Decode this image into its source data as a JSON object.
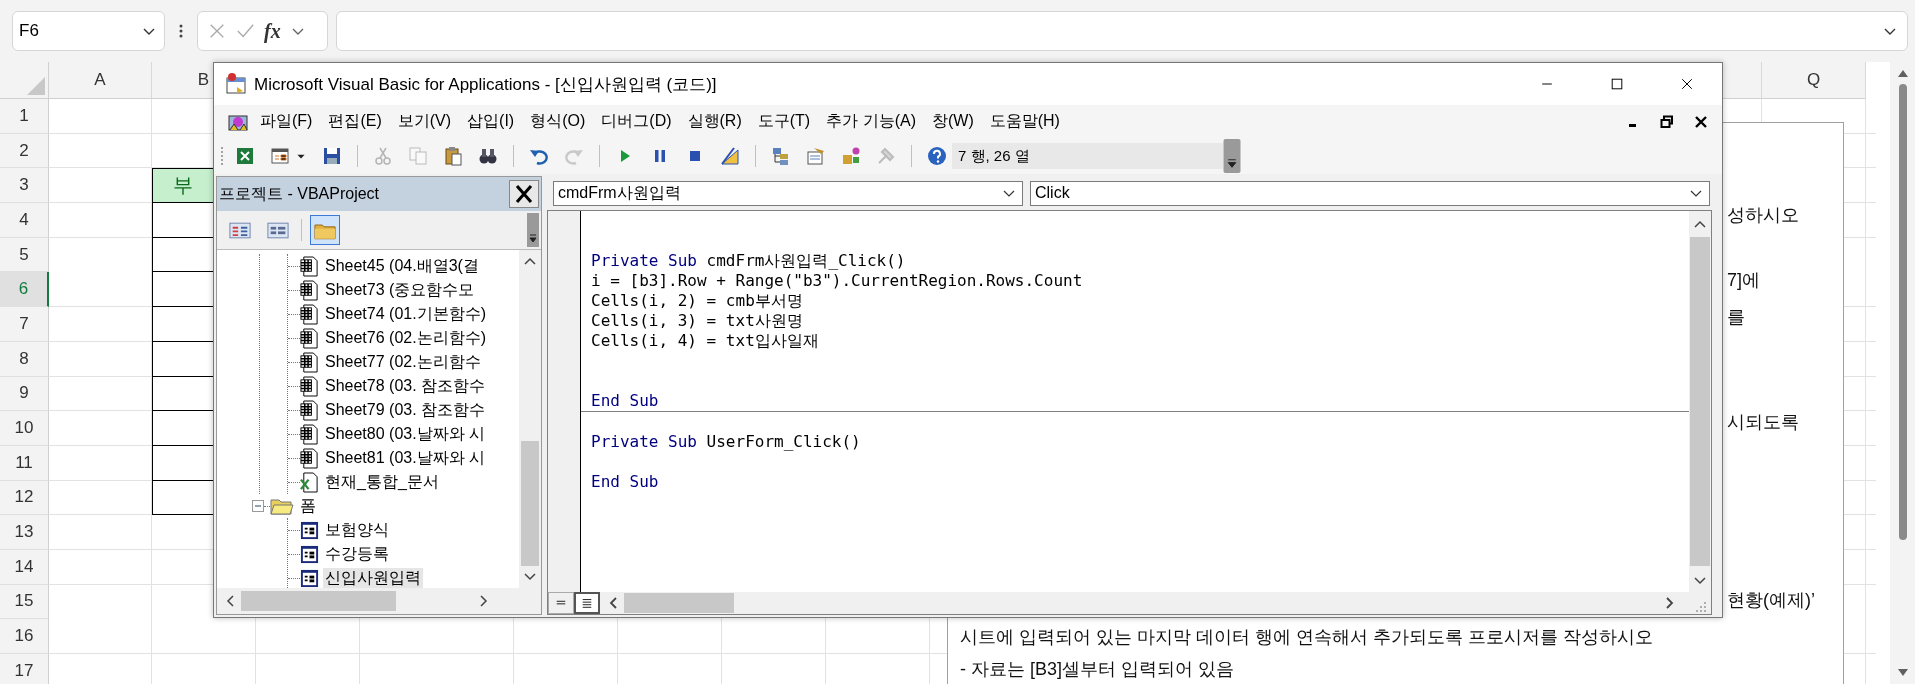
{
  "formula_bar": {
    "name_box": "F6",
    "function_label": "fx"
  },
  "sheet": {
    "columns": [
      {
        "label": "A"
      },
      {
        "label": "B"
      },
      {
        "label": "Q"
      }
    ],
    "rows": [
      {
        "label": "1",
        "selected": false
      },
      {
        "label": "2",
        "selected": false
      },
      {
        "label": "3",
        "selected": false
      },
      {
        "label": "4",
        "selected": false
      },
      {
        "label": "5",
        "selected": false
      },
      {
        "label": "6",
        "selected": true
      },
      {
        "label": "7",
        "selected": false
      },
      {
        "label": "8",
        "selected": false
      },
      {
        "label": "9",
        "selected": false
      },
      {
        "label": "10",
        "selected": false
      },
      {
        "label": "11",
        "selected": false
      },
      {
        "label": "12",
        "selected": false
      },
      {
        "label": "13",
        "selected": false
      },
      {
        "label": "14",
        "selected": false
      },
      {
        "label": "15",
        "selected": false
      },
      {
        "label": "16",
        "selected": false
      },
      {
        "label": "17",
        "selected": false
      }
    ],
    "table_header": "부"
  },
  "text_box": {
    "lines": [
      "성하시오",
      "7]에",
      "를",
      "시되도록",
      "현황(예제)’",
      "시트에 입력되어 있는 마지막 데이터 행에 연속해서 추가되도록 프로시저를 작성하시오",
      "- 자료는 [B3]셀부터 입력되어 있음"
    ]
  },
  "vba_window": {
    "title": "Microsoft Visual Basic for Applications - [신입사원입력 (코드)]",
    "menu": [
      "파일(F)",
      "편집(E)",
      "보기(V)",
      "삽입(I)",
      "형식(O)",
      "디버그(D)",
      "실행(R)",
      "도구(T)",
      "추가 기능(A)",
      "창(W)",
      "도움말(H)"
    ],
    "toolbar": [
      {
        "kind": "excel",
        "disabled": false
      },
      {
        "kind": "insert-form",
        "disabled": false
      },
      {
        "kind": "dropdown",
        "disabled": false
      },
      {
        "kind": "save",
        "disabled": false
      },
      {
        "kind": "separator"
      },
      {
        "kind": "cut",
        "disabled": true
      },
      {
        "kind": "copy",
        "disabled": true
      },
      {
        "kind": "paste",
        "disabled": false
      },
      {
        "kind": "find",
        "disabled": false
      },
      {
        "kind": "separator"
      },
      {
        "kind": "undo",
        "disabled": false
      },
      {
        "kind": "redo",
        "disabled": true
      },
      {
        "kind": "separator"
      },
      {
        "kind": "run",
        "disabled": false
      },
      {
        "kind": "pause",
        "disabled": false
      },
      {
        "kind": "stop",
        "disabled": false
      },
      {
        "kind": "design",
        "disabled": false
      },
      {
        "kind": "separator"
      },
      {
        "kind": "project",
        "disabled": false
      },
      {
        "kind": "properties",
        "disabled": false
      },
      {
        "kind": "browser",
        "disabled": false
      },
      {
        "kind": "toolbox",
        "disabled": true
      },
      {
        "kind": "separator"
      },
      {
        "kind": "help",
        "disabled": false
      }
    ],
    "cursor_position": "7 행, 26 열",
    "project": {
      "title": "프로젝트 - VBAProject",
      "buttons": [
        {
          "kind": "view-code",
          "selected": false
        },
        {
          "kind": "view-object",
          "selected": false
        },
        {
          "kind": "toggle-folders",
          "selected": true
        }
      ],
      "tree": [
        {
          "children": [
            {
              "kind": "sheet",
              "label": "Sheet45 (04.배열3(결",
              "selected": false
            },
            {
              "kind": "sheet",
              "label": "Sheet73 (중요함수모",
              "selected": false
            },
            {
              "kind": "sheet",
              "label": "Sheet74 (01.기본함수)",
              "selected": false
            },
            {
              "kind": "sheet",
              "label": "Sheet76 (02.논리함수)",
              "selected": false
            },
            {
              "kind": "sheet",
              "label": "Sheet77 (02.논리함수",
              "selected": false
            },
            {
              "kind": "sheet",
              "label": "Sheet78 (03. 참조함수",
              "selected": false
            },
            {
              "kind": "sheet",
              "label": "Sheet79 (03. 참조함수",
              "selected": false
            },
            {
              "kind": "sheet",
              "label": "Sheet80 (03.날짜와 시",
              "selected": false
            },
            {
              "kind": "sheet",
              "label": "Sheet81 (03.날짜와 시",
              "selected": false
            },
            {
              "kind": "workbook",
              "label": "현재_통합_문서",
              "selected": false
            }
          ]
        },
        {
          "kind": "folder",
          "label": "폼",
          "expanded": true,
          "children": [
            {
              "kind": "form",
              "label": "보험양식",
              "selected": false
            },
            {
              "kind": "form",
              "label": "수강등록",
              "selected": false
            },
            {
              "kind": "form",
              "label": "신입사원입력",
              "selected": true
            }
          ]
        }
      ]
    },
    "code": {
      "object": "cmdFrm사원입력",
      "procedure": "Click",
      "procedures": [
        {
          "lines": [
            {
              "kind": "blank"
            },
            {
              "kind": "blank"
            },
            {
              "kind": "code",
              "tokens": [
                {
                  "kind": "keyword",
                  "text": "Private Sub"
                },
                {
                  "kind": "plain",
                  "text": " cmdFrm사원입력_Click()"
                }
              ]
            },
            {
              "kind": "code",
              "tokens": [
                {
                  "kind": "plain",
                  "text": "i = [b3].Row + Range(\"b3\").CurrentRegion.Rows.Count"
                }
              ]
            },
            {
              "kind": "code",
              "tokens": [
                {
                  "kind": "plain",
                  "text": "Cells(i, 2) = cmb부서명"
                }
              ]
            },
            {
              "kind": "code",
              "tokens": [
                {
                  "kind": "plain",
                  "text": "Cells(i, 3) = txt사원명"
                }
              ]
            },
            {
              "kind": "code",
              "tokens": [
                {
                  "kind": "plain",
                  "text": "Cells(i, 4) = txt입사일재"
                }
              ]
            },
            {
              "kind": "blank"
            },
            {
              "kind": "blank"
            },
            {
              "kind": "code",
              "tokens": [
                {
                  "kind": "keyword",
                  "text": "End Sub"
                }
              ]
            }
          ]
        },
        {
          "lines": [
            {
              "kind": "blank"
            },
            {
              "kind": "code",
              "tokens": [
                {
                  "kind": "keyword",
                  "text": "Private Sub"
                },
                {
                  "kind": "plain",
                  "text": " UserForm_Click()"
                }
              ]
            },
            {
              "kind": "blank"
            },
            {
              "kind": "code",
              "tokens": [
                {
                  "kind": "keyword",
                  "text": "End Sub"
                }
              ]
            }
          ]
        }
      ],
      "views": [
        {
          "kind": "procedure",
          "selected": false
        },
        {
          "kind": "module",
          "selected": true
        }
      ]
    }
  }
}
